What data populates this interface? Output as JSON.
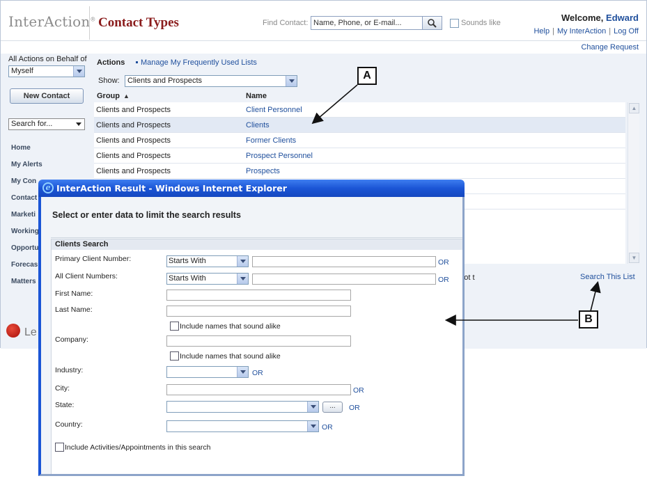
{
  "header": {
    "logo": "InterAction",
    "logo_mark": "®",
    "title": "Contact Types",
    "find_label": "Find Contact:",
    "find_placeholder": "Name, Phone, or E-mail...",
    "sounds_like": "Sounds like",
    "welcome": "Welcome,",
    "user": "Edward",
    "links": [
      "Help",
      "My InterAction",
      "Log Off"
    ],
    "change_request": "Change Request"
  },
  "sidebar": {
    "behalf_label": "All Actions on Behalf of",
    "behalf_value": "Myself",
    "new_contact": "New Contact",
    "search_for": "Search for...",
    "nav": [
      "Home",
      "My Alerts",
      "My Con",
      "Contact",
      "Marketi",
      "Working",
      "Opportu",
      "Forecas",
      "Matters"
    ],
    "brand_text": "Le"
  },
  "main": {
    "actions_label": "Actions",
    "manage_link": "Manage My Frequently Used Lists",
    "show_label": "Show:",
    "show_value": "Clients and Prospects",
    "columns": {
      "group": "Group",
      "name": "Name"
    },
    "rows": [
      {
        "group": "Clients and Prospects",
        "name": "Client Personnel"
      },
      {
        "group": "Clients and Prospects",
        "name": "Clients"
      },
      {
        "group": "Clients and Prospects",
        "name": "Former Clients"
      },
      {
        "group": "Clients and Prospects",
        "name": "Prospect Personnel"
      },
      {
        "group": "Clients and Prospects",
        "name": "Prospects"
      },
      {
        "group": "",
        "name": ""
      },
      {
        "group": "",
        "name": ""
      }
    ],
    "footer_text": "r, not t",
    "search_this_list": "Search This List"
  },
  "popup": {
    "window_title": "InterAction Result - Windows Internet Explorer",
    "heading": "Select or enter data to limit the search results",
    "panel_title": "Clients Search",
    "fields": {
      "primary_client_number": "Primary Client Number:",
      "all_client_numbers": "All Client Numbers:",
      "first_name": "First Name:",
      "last_name": "Last Name:",
      "company": "Company:",
      "industry": "Industry:",
      "city": "City:",
      "state": "State:",
      "country": "Country:"
    },
    "starts_with": "Starts With",
    "or": "OR",
    "sound_alike": "Include names that sound alike",
    "dots": "...",
    "include_activities": "Include Activities/Appointments in this search"
  },
  "callouts": {
    "a": "A",
    "b": "B"
  }
}
